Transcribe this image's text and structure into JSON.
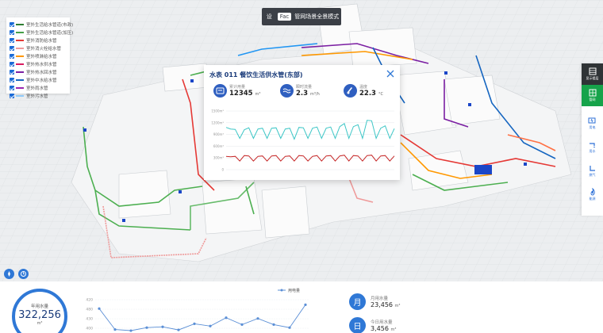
{
  "mode_bar": {
    "btn_a": "设",
    "btn_b": "Fac",
    "mode_label": "管网场景全景模式"
  },
  "legend": {
    "items": [
      {
        "label": "室外生活给水管道(市政)",
        "color": "#2e7d32"
      },
      {
        "label": "室外生活给水管道(加压)",
        "color": "#43a047"
      },
      {
        "label": "室外消防给水管",
        "color": "#e53935"
      },
      {
        "label": "室外消火栓给水管",
        "color": "#ef9a9a"
      },
      {
        "label": "室外喷淋给水管",
        "color": "#ff9800"
      },
      {
        "label": "室外热水供水管",
        "color": "#d81b60"
      },
      {
        "label": "室外热水回水管",
        "color": "#7b1fa2"
      },
      {
        "label": "室外中水给水管",
        "color": "#1565c0"
      },
      {
        "label": "室外雨水管",
        "color": "#9c27b0"
      },
      {
        "label": "室外污水管",
        "color": "#90caf9"
      }
    ]
  },
  "popup": {
    "title": "水表 011 餐饮生活供水管(东部)",
    "stats": [
      {
        "label": "累计用量",
        "value": "12345",
        "unit": "m³"
      },
      {
        "label": "瞬时流量",
        "value": "2.3",
        "unit": "m³/h"
      },
      {
        "label": "温度",
        "value": "22.3",
        "unit": "°C"
      }
    ]
  },
  "toolbar": {
    "items": [
      {
        "label": "显示楼层"
      },
      {
        "label": "管网"
      },
      {
        "label": "用电"
      },
      {
        "label": "用水"
      },
      {
        "label": "燃气"
      },
      {
        "label": "能源"
      }
    ]
  },
  "bottom": {
    "year_label": "年用水量",
    "year_value": "322,256",
    "year_unit": "m³",
    "legend": "用电量",
    "month_label": "月用水量",
    "month_value": "23,456",
    "month_unit": "m³",
    "day_label": "今日用水量",
    "day_value": "3,456",
    "day_unit": "m³",
    "month_icon": "月",
    "day_icon": "日"
  },
  "chart_data": [
    {
      "type": "line",
      "title": "",
      "yticks": [
        "1500m³",
        "1200m³",
        "900m³",
        "600m³",
        "300m³",
        "0"
      ],
      "ylim": [
        0,
        1500
      ],
      "series": [
        {
          "color": "#3cc6c6",
          "values": [
            1080,
            1040,
            1030,
            800,
            1020,
            1070,
            800,
            1040,
            1060,
            800,
            1060,
            1070,
            800,
            1040,
            1060,
            780,
            1080,
            1070,
            800,
            1060,
            1090,
            800,
            1060,
            1090,
            800,
            1100,
            1180,
            800,
            1100,
            1150,
            800,
            1260,
            1250,
            800,
            1060,
            1120,
            800,
            1050
          ]
        },
        {
          "color": "#c62828",
          "values": [
            340,
            330,
            340,
            220,
            360,
            350,
            220,
            340,
            350,
            220,
            350,
            360,
            220,
            340,
            350,
            220,
            360,
            350,
            220,
            340,
            360,
            220,
            350,
            360,
            220,
            350,
            370,
            220,
            360,
            350,
            220,
            360,
            370,
            220,
            350,
            360,
            220,
            350
          ]
        }
      ]
    },
    {
      "type": "line",
      "title": "",
      "yticks": [
        "420",
        "480",
        "430",
        "400"
      ],
      "ylim": [
        400,
        500
      ],
      "series": [
        {
          "name": "用电量",
          "color": "#5b8fd6",
          "values": [
            460,
            405,
            402,
            410,
            412,
            404,
            420,
            414,
            436,
            418,
            434,
            418,
            410,
            470
          ]
        }
      ]
    }
  ]
}
